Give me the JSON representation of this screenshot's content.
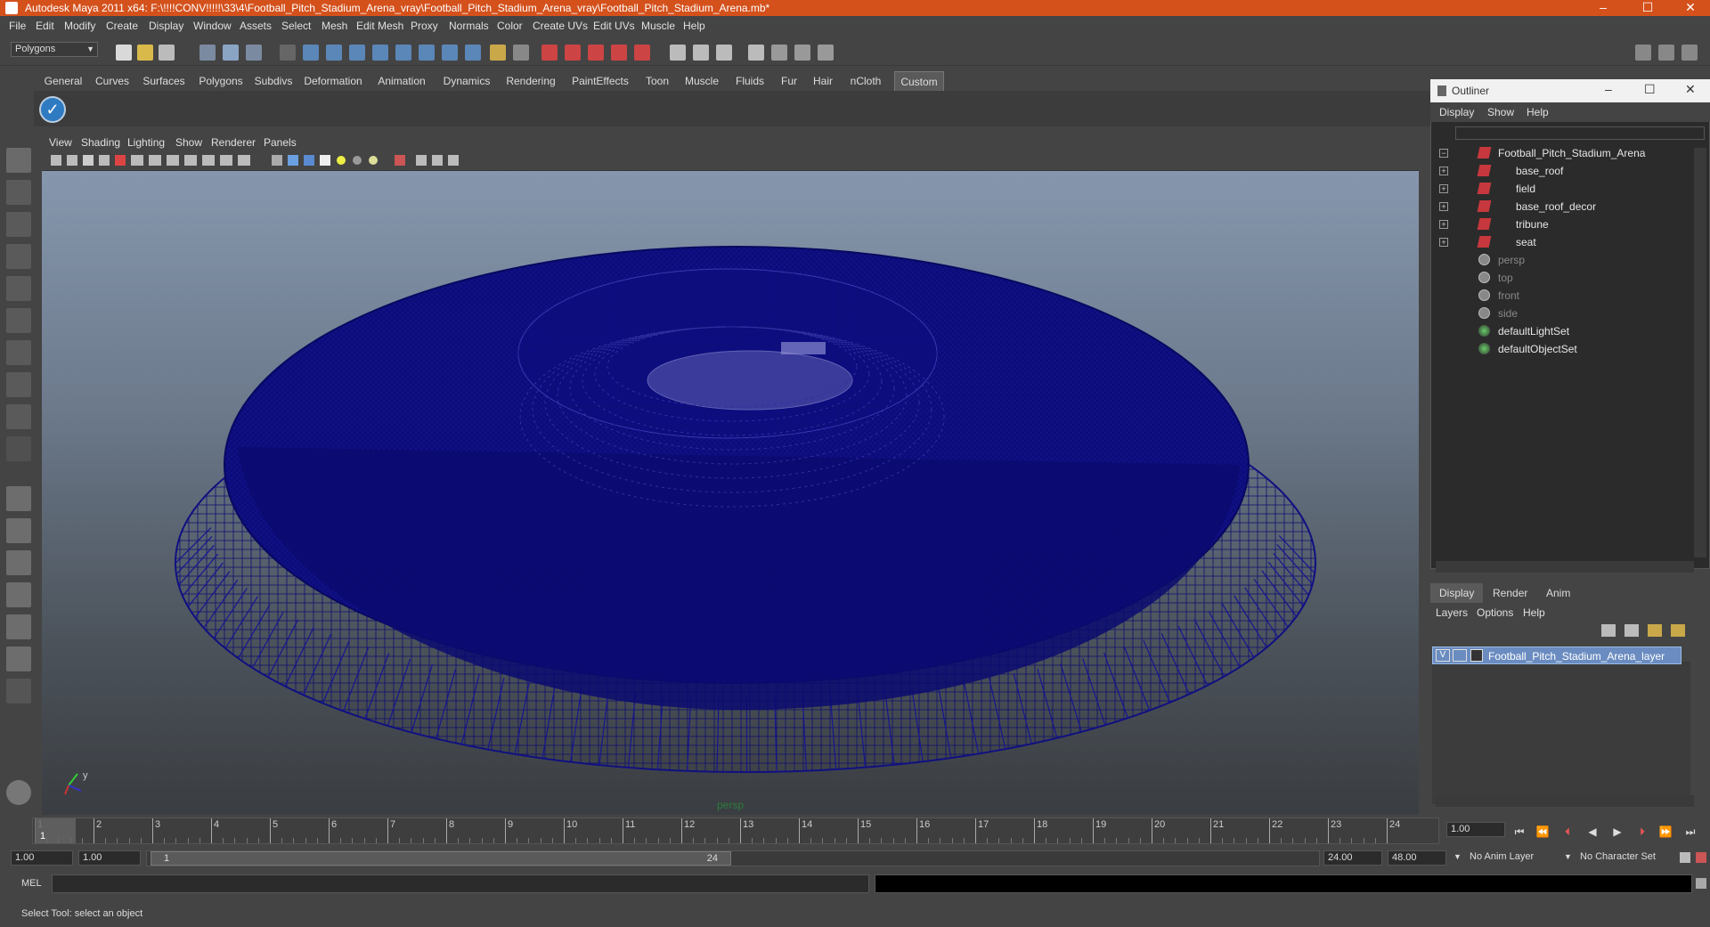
{
  "window": {
    "title": "Autodesk Maya 2011 x64: F:\\!!!!CONV!!!!!\\33\\4\\Football_Pitch_Stadium_Arena_vray\\Football_Pitch_Stadium_Arena_vray\\Football_Pitch_Stadium_Arena.mb*",
    "controls": [
      "minimize",
      "maximize",
      "close"
    ]
  },
  "menubar": [
    "File",
    "Edit",
    "Modify",
    "Create",
    "Display",
    "Window",
    "Assets",
    "Select",
    "Mesh",
    "Edit Mesh",
    "Proxy",
    "Normals",
    "Color",
    "Create UVs",
    "Edit UVs",
    "Muscle",
    "Help"
  ],
  "toolbar": {
    "mode": "Polygons"
  },
  "shelf": {
    "tabs": [
      "General",
      "Curves",
      "Surfaces",
      "Polygons",
      "Subdivs",
      "Deformation",
      "Animation",
      "Dynamics",
      "Rendering",
      "PaintEffects",
      "Toon",
      "Muscle",
      "Fluids",
      "Fur",
      "Hair",
      "nCloth",
      "Custom"
    ],
    "active_tab": "Custom"
  },
  "viewport": {
    "menu": [
      "View",
      "Shading",
      "Lighting",
      "Show",
      "Renderer",
      "Panels"
    ],
    "camera_label": "persp",
    "axis_y": "y",
    "wire_color": "#0a0a73"
  },
  "outliner": {
    "title": "Outliner",
    "menu": [
      "Display",
      "Show",
      "Help"
    ],
    "items": [
      {
        "label": "Football_Pitch_Stadium_Arena",
        "type": "mesh",
        "expand": "−",
        "indent": 0
      },
      {
        "label": "base_roof",
        "type": "mesh",
        "expand": "+",
        "indent": 1
      },
      {
        "label": "field",
        "type": "mesh",
        "expand": "+",
        "indent": 1
      },
      {
        "label": "base_roof_decor",
        "type": "mesh",
        "expand": "+",
        "indent": 1
      },
      {
        "label": "tribune",
        "type": "mesh",
        "expand": "+",
        "indent": 1
      },
      {
        "label": "seat",
        "type": "mesh",
        "expand": "+",
        "indent": 1
      },
      {
        "label": "persp",
        "type": "camera",
        "expand": "",
        "indent": 0,
        "dim": true
      },
      {
        "label": "top",
        "type": "camera",
        "expand": "",
        "indent": 0,
        "dim": true
      },
      {
        "label": "front",
        "type": "camera",
        "expand": "",
        "indent": 0,
        "dim": true
      },
      {
        "label": "side",
        "type": "camera",
        "expand": "",
        "indent": 0,
        "dim": true
      },
      {
        "label": "defaultLightSet",
        "type": "set",
        "expand": "",
        "indent": 0
      },
      {
        "label": "defaultObjectSet",
        "type": "set",
        "expand": "",
        "indent": 0
      }
    ]
  },
  "layers": {
    "tabs": [
      "Display",
      "Render",
      "Anim"
    ],
    "active_tab": "Display",
    "menu": [
      "Layers",
      "Options",
      "Help"
    ],
    "layer": {
      "visible": "V",
      "name": "Football_Pitch_Stadium_Arena_layer"
    }
  },
  "timeline": {
    "ticks": [
      "1",
      "2",
      "3",
      "4",
      "5",
      "6",
      "7",
      "8",
      "9",
      "10",
      "11",
      "12",
      "13",
      "14",
      "15",
      "16",
      "17",
      "18",
      "19",
      "20",
      "21",
      "22",
      "23",
      "24"
    ],
    "current_frame_label": "1",
    "current_time": "1.00"
  },
  "range": {
    "start": "1.00",
    "start_inner": "1.00",
    "slider_start": "1",
    "slider_end": "24",
    "end_inner": "24.00",
    "end": "48.00",
    "anim_layer": "No Anim Layer",
    "character_set": "No Character Set"
  },
  "command": {
    "lang": "MEL",
    "value": ""
  },
  "help_line": "Select Tool: select an object"
}
